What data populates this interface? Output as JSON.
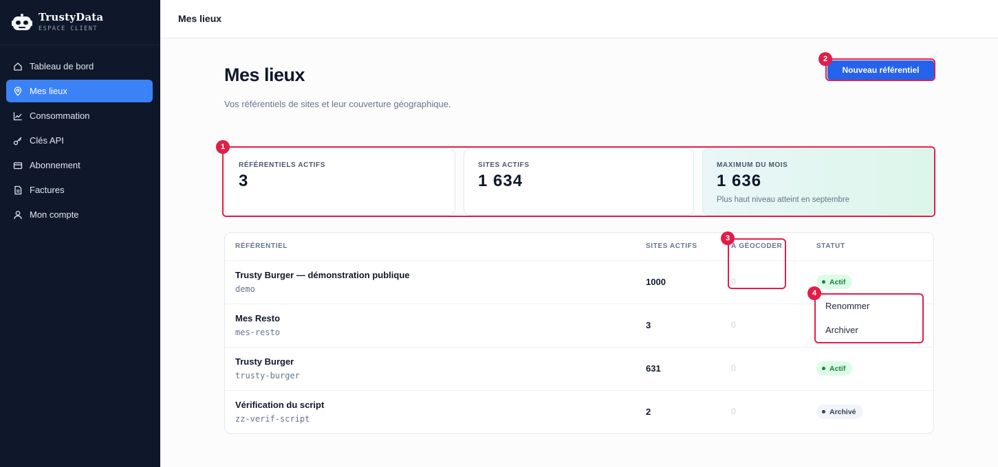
{
  "brand": {
    "name": "TrustyData",
    "subtitle": "ESPACE CLIENT"
  },
  "sidebar": {
    "items": [
      {
        "label": "Tableau de bord",
        "icon": "home-icon"
      },
      {
        "label": "Mes lieux",
        "icon": "map-pin-icon",
        "active": true
      },
      {
        "label": "Consommation",
        "icon": "chart-line-icon"
      },
      {
        "label": "Clés API",
        "icon": "key-icon"
      },
      {
        "label": "Abonnement",
        "icon": "credit-card-icon"
      },
      {
        "label": "Factures",
        "icon": "invoice-icon"
      },
      {
        "label": "Mon compte",
        "icon": "user-icon"
      }
    ]
  },
  "topbar": {
    "title": "Mes lieux"
  },
  "header": {
    "title": "Mes lieux",
    "subtitle": "Vos référentiels de sites et leur couverture géographique.",
    "new_button": "Nouveau référentiel"
  },
  "stats": [
    {
      "label": "RÉFÉRENTIELS ACTIFS",
      "value": "3",
      "note": ""
    },
    {
      "label": "SITES ACTIFS",
      "value": "1 634",
      "note": ""
    },
    {
      "label": "MAXIMUM DU MOIS",
      "value": "1 636",
      "note": "Plus haut niveau atteint en septembre"
    }
  ],
  "table": {
    "headers": {
      "name": "RÉFÉRENTIEL",
      "sites": "SITES ACTIFS",
      "geo": "À GÉOCODER",
      "status": "STATUT"
    },
    "rows": [
      {
        "name": "Trusty Burger — démonstration publique",
        "slug": "demo",
        "sites": "1000",
        "geo": "0",
        "status": "Actif"
      },
      {
        "name": "Mes Resto",
        "slug": "mes-resto",
        "sites": "3",
        "geo": "0",
        "status": ""
      },
      {
        "name": "Trusty Burger",
        "slug": "trusty-burger",
        "sites": "631",
        "geo": "0",
        "status": "Actif"
      },
      {
        "name": "Vérification du script",
        "slug": "zz-verif-script",
        "sites": "2",
        "geo": "0",
        "status": "Archivé"
      }
    ]
  },
  "menu": {
    "items": [
      "Renommer",
      "Archiver"
    ]
  },
  "annotations": [
    "1",
    "2",
    "3",
    "4"
  ],
  "colors": {
    "sidebar": "#0f172a",
    "accent": "#2563eb",
    "annotation": "#e11d48",
    "success": "#15803d"
  }
}
